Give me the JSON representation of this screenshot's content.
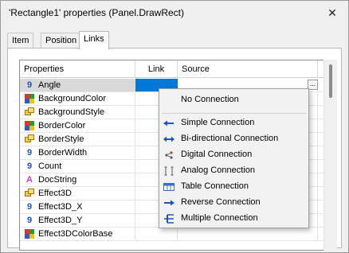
{
  "window": {
    "title": "'Rectangle1' properties (Panel.DrawRect)",
    "close_glyph": "✕"
  },
  "tabs": [
    {
      "label": "Item",
      "active": false
    },
    {
      "label": "Position",
      "active": false
    },
    {
      "label": "Links",
      "active": true
    }
  ],
  "grid": {
    "columns": [
      "Properties",
      "Link",
      "Source"
    ],
    "rows": [
      {
        "name": "Angle",
        "icon": "number-icon",
        "selected": true
      },
      {
        "name": "BackgroundColor",
        "icon": "color-icon"
      },
      {
        "name": "BackgroundStyle",
        "icon": "style-icon"
      },
      {
        "name": "BorderColor",
        "icon": "color-icon"
      },
      {
        "name": "BorderStyle",
        "icon": "style-icon"
      },
      {
        "name": "BorderWidth",
        "icon": "number-icon"
      },
      {
        "name": "Count",
        "icon": "number-icon"
      },
      {
        "name": "DocString",
        "icon": "text-icon"
      },
      {
        "name": "Effect3D",
        "icon": "style-icon"
      },
      {
        "name": "Effect3D_X",
        "icon": "number-icon"
      },
      {
        "name": "Effect3D_Y",
        "icon": "number-icon"
      },
      {
        "name": "Effect3DColorBase",
        "icon": "color-icon"
      }
    ],
    "dots_label": "..."
  },
  "menu": {
    "items": [
      {
        "label": "No Connection",
        "icon": "none"
      },
      {
        "label": "Simple Connection",
        "icon": "simple-connection-icon"
      },
      {
        "label": "Bi-directional Connection",
        "icon": "bidirectional-connection-icon"
      },
      {
        "label": "Digital Connection",
        "icon": "digital-connection-icon"
      },
      {
        "label": "Analog Connection",
        "icon": "analog-connection-icon"
      },
      {
        "label": "Table Connection",
        "icon": "table-connection-icon"
      },
      {
        "label": "Reverse Connection",
        "icon": "reverse-connection-icon"
      },
      {
        "label": "Multiple Connection",
        "icon": "multiple-connection-icon"
      }
    ]
  },
  "colors": {
    "selection": "#0078d7",
    "icon_blue": "#1a55c8",
    "text_icon": "#c040c0",
    "style_icon": "#d4a300"
  }
}
